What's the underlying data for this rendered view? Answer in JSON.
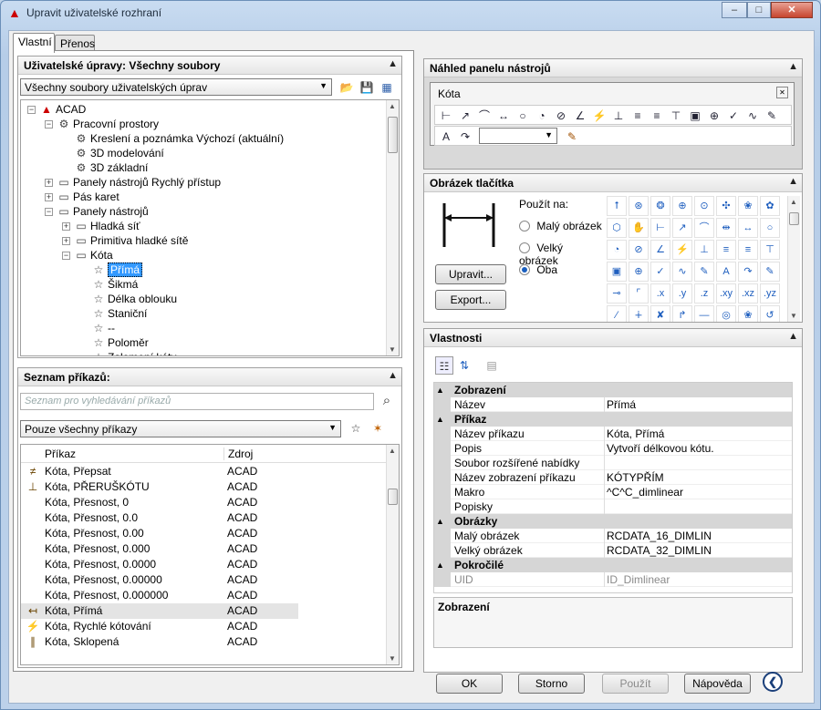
{
  "window": {
    "title": "Upravit uživatelské rozhraní",
    "min": "–",
    "max": "□",
    "close": "✕"
  },
  "tabs": [
    {
      "label": "Vlastní"
    },
    {
      "label": "Přenos"
    }
  ],
  "customizations": {
    "header": "Uživatelské úpravy: Všechny soubory",
    "collapse": "▲",
    "filter_value": "Všechny soubory uživatelských úprav",
    "tree": [
      {
        "label": "ACAD",
        "level": 0,
        "exp": "−",
        "icon": "▲"
      },
      {
        "label": "Pracovní prostory",
        "level": 1,
        "exp": "−",
        "icon": "⚙"
      },
      {
        "label": "Kreslení a poznámka Výchozí (aktuální)",
        "level": 2,
        "exp": "",
        "icon": "⚙"
      },
      {
        "label": "3D modelování",
        "level": 2,
        "exp": "",
        "icon": "⚙"
      },
      {
        "label": "3D základní",
        "level": 2,
        "exp": "",
        "icon": "⚙"
      },
      {
        "label": "Panely nástrojů Rychlý přístup",
        "level": 1,
        "exp": "+",
        "icon": "▭"
      },
      {
        "label": "Pás karet",
        "level": 1,
        "exp": "+",
        "icon": "▭"
      },
      {
        "label": "Panely nástrojů",
        "level": 1,
        "exp": "−",
        "icon": "▭"
      },
      {
        "label": "Hladká síť",
        "level": 2,
        "exp": "+",
        "icon": "▭"
      },
      {
        "label": "Primitiva hladké sítě",
        "level": 2,
        "exp": "+",
        "icon": "▭"
      },
      {
        "label": "Kóta",
        "level": 2,
        "exp": "−",
        "icon": "▭"
      },
      {
        "label": "Přímá",
        "level": 3,
        "exp": "",
        "icon": "☆",
        "selected": true
      },
      {
        "label": "Šikmá",
        "level": 3,
        "exp": "",
        "icon": "☆"
      },
      {
        "label": "Délka oblouku",
        "level": 3,
        "exp": "",
        "icon": "☆"
      },
      {
        "label": "Staniční",
        "level": 3,
        "exp": "",
        "icon": "☆"
      },
      {
        "label": "--",
        "level": 3,
        "exp": "",
        "icon": "☆"
      },
      {
        "label": "Poloměr",
        "level": 3,
        "exp": "",
        "icon": "☆"
      },
      {
        "label": "Zalomení kóty",
        "level": 3,
        "exp": "",
        "icon": "☆"
      }
    ]
  },
  "commands": {
    "header": "Seznam příkazů:",
    "collapse": "▲",
    "search_placeholder": "Seznam pro vyhledávání příkazů",
    "filter_value": "Pouze všechny příkazy",
    "col_command": "Příkaz",
    "col_source": "Zdroj",
    "rows": [
      {
        "name": "Kóta, Přepsat",
        "src": "ACAD",
        "icon": "≠"
      },
      {
        "name": "Kóta, PŘERUŠKÓTU",
        "src": "ACAD",
        "icon": "⊥"
      },
      {
        "name": "Kóta, Přesnost, 0",
        "src": "ACAD",
        "icon": ""
      },
      {
        "name": "Kóta, Přesnost, 0.0",
        "src": "ACAD",
        "icon": ""
      },
      {
        "name": "Kóta, Přesnost, 0.00",
        "src": "ACAD",
        "icon": ""
      },
      {
        "name": "Kóta, Přesnost, 0.000",
        "src": "ACAD",
        "icon": ""
      },
      {
        "name": "Kóta, Přesnost, 0.0000",
        "src": "ACAD",
        "icon": ""
      },
      {
        "name": "Kóta, Přesnost, 0.00000",
        "src": "ACAD",
        "icon": ""
      },
      {
        "name": "Kóta, Přesnost, 0.000000",
        "src": "ACAD",
        "icon": ""
      },
      {
        "name": "Kóta, Přímá",
        "src": "ACAD",
        "icon": "↤",
        "highlight": true
      },
      {
        "name": "Kóta, Rychlé kótování",
        "src": "ACAD",
        "icon": "⚡"
      },
      {
        "name": "Kóta, Sklopená",
        "src": "ACAD",
        "icon": "∥"
      }
    ]
  },
  "toolbar_preview": {
    "header": "Náhled panelu nástrojů",
    "collapse": "▲",
    "toolbar_title": "Kóta",
    "toolbar_close": "✕",
    "icons": [
      "⊢",
      "↗",
      "⌒",
      "↔",
      "○",
      "◔",
      "⊘",
      "∠",
      "⚡",
      "⊥",
      "≡",
      "≡",
      "⊤",
      "▣",
      "⊕",
      "✓",
      "∿",
      "✎"
    ],
    "icons2": [
      "A",
      "↷"
    ],
    "style_value": "",
    "style_icon": "✎"
  },
  "button_image": {
    "header": "Obrázek tlačítka",
    "collapse": "▲",
    "use_on": "Použít na:",
    "radios": [
      {
        "label": "Malý obrázek",
        "checked": false
      },
      {
        "label": "Velký obrázek",
        "checked": false
      },
      {
        "label": "Oba",
        "checked": true
      }
    ],
    "edit_btn": "Upravit...",
    "export_btn": "Export...",
    "gallery": [
      "⭡",
      "⊛",
      "❂",
      "⊕",
      "⊙",
      "✣",
      "❀",
      "✿",
      "⬡",
      "✋",
      "⊢",
      "↗",
      "⌒",
      "⇹",
      "↔",
      "○",
      "◔",
      "⊘",
      "∠",
      "⚡",
      "⊥",
      "≡",
      "≡",
      "⊤",
      "▣",
      "⊕",
      "✓",
      "∿",
      "✎",
      "A",
      "↷",
      "✎",
      "⊸",
      "⌜",
      ".x",
      ".y",
      ".z",
      ".xy",
      ".xz",
      ".yz",
      "∕",
      "∔",
      "✘",
      "↱",
      "—",
      "◎",
      "❀",
      "↺"
    ]
  },
  "properties": {
    "header": "Vlastnosti",
    "collapse": "▲",
    "rows": [
      {
        "cat": true,
        "label": "Zobrazení"
      },
      {
        "label": "Název",
        "value": "Přímá"
      },
      {
        "cat": true,
        "label": "Příkaz"
      },
      {
        "label": "Název příkazu",
        "value": "Kóta, Přímá"
      },
      {
        "label": "Popis",
        "value": "Vytvoří délkovou kótu."
      },
      {
        "label": "Soubor rozšířené nabídky",
        "value": ""
      },
      {
        "label": "Název zobrazení příkazu",
        "value": "KÓTYPŘÍM"
      },
      {
        "label": "Makro",
        "value": "^C^C_dimlinear"
      },
      {
        "label": "Popisky",
        "value": ""
      },
      {
        "cat": true,
        "label": "Obrázky"
      },
      {
        "label": "Malý obrázek",
        "value": "RCDATA_16_DIMLIN"
      },
      {
        "label": "Velký obrázek",
        "value": "RCDATA_32_DIMLIN"
      },
      {
        "cat": true,
        "label": "Pokročilé"
      },
      {
        "label": "UID",
        "value": "ID_Dimlinear",
        "muted": true
      }
    ],
    "description_title": "Zobrazení"
  },
  "footer": {
    "ok": "OK",
    "cancel": "Storno",
    "apply": "Použít",
    "help": "Nápověda",
    "collapse_icon": "❮"
  }
}
